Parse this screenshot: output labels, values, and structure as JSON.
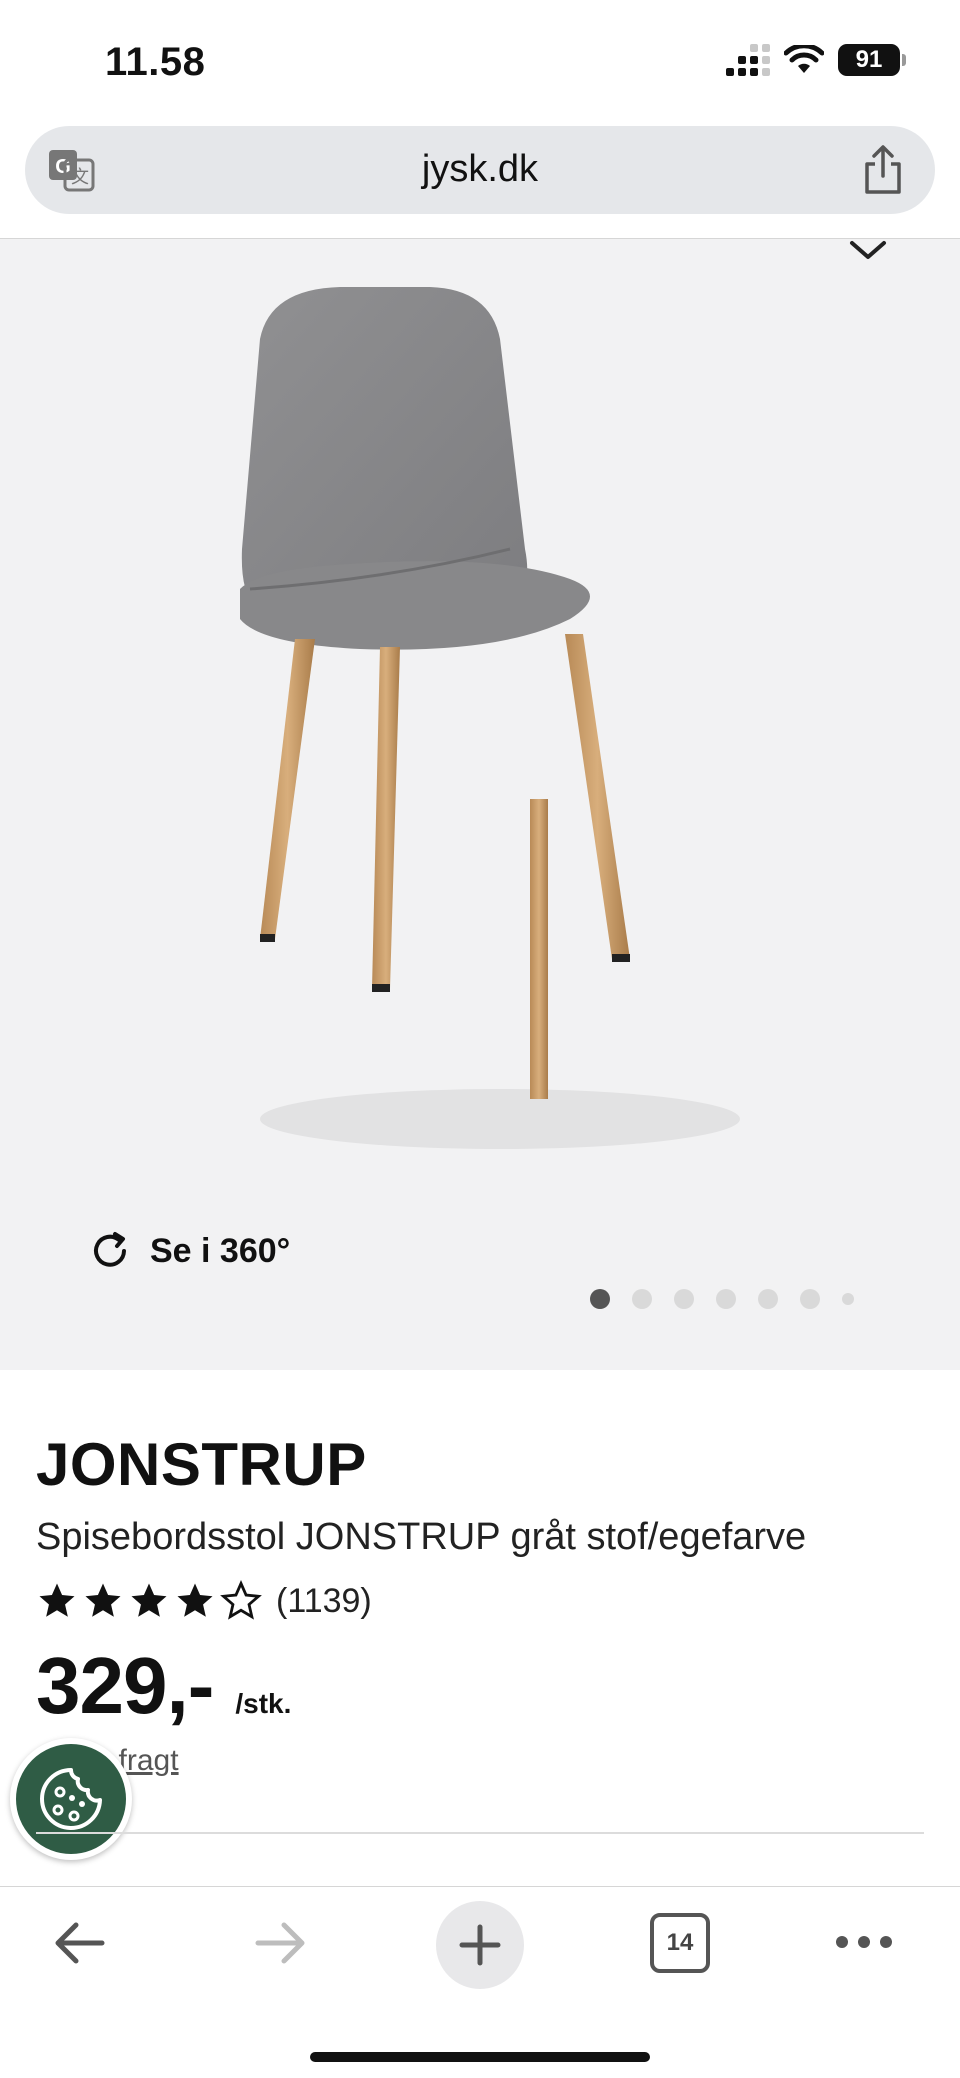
{
  "status_bar": {
    "time": "11.58",
    "battery": "91"
  },
  "browser": {
    "url": "jysk.dk",
    "tab_count": "14"
  },
  "gallery": {
    "view360_label": "Se i 360°",
    "image_count": 7,
    "active_index": 0
  },
  "product": {
    "name": "JONSTRUP",
    "subtitle": "Spisebordsstol JONSTRUP gråt stof/egefarve",
    "rating": 4.5,
    "rating_max": 5,
    "rating_count": "(1139)",
    "price": "329,-",
    "price_unit": "/stk.",
    "shipping": "+ evt. fragt"
  },
  "colors": {
    "cookie_button": "#2f5c45",
    "hero_background": "#f2f2f3"
  },
  "icons": {
    "translate": "translate-icon",
    "share": "share-icon",
    "rotate": "rotate-360-icon",
    "cookie": "cookie-icon",
    "back": "back-arrow-icon",
    "forward": "forward-arrow-icon",
    "new_tab": "plus-icon",
    "more": "more-icon"
  }
}
